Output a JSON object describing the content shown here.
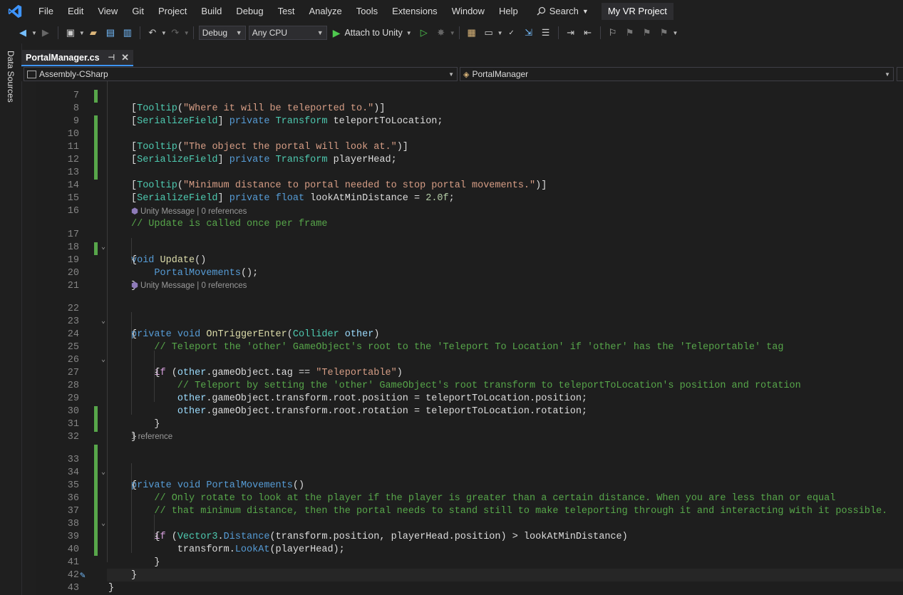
{
  "menubar": {
    "items": [
      "File",
      "Edit",
      "View",
      "Git",
      "Project",
      "Build",
      "Debug",
      "Test",
      "Analyze",
      "Tools",
      "Extensions",
      "Window",
      "Help"
    ],
    "search_label": "Search",
    "project_title": "My VR Project"
  },
  "toolbar": {
    "configuration": "Debug",
    "platform": "Any CPU",
    "attach_label": "Attach to Unity"
  },
  "side_panel": {
    "label": "Data Sources"
  },
  "tab": {
    "label": "PortalManager.cs"
  },
  "navbar": {
    "left": "Assembly-CSharp",
    "right": "PortalManager"
  },
  "code_lens": {
    "unity_message": "Unity Message | 0 references",
    "one_reference": "1 reference"
  },
  "code": {
    "line_numbers": [
      "7",
      "8",
      "9",
      "10",
      "11",
      "12",
      "13",
      "14",
      "15",
      "16",
      "17",
      "18",
      "19",
      "20",
      "21",
      "22",
      "23",
      "24",
      "25",
      "26",
      "27",
      "28",
      "29",
      "30",
      "31",
      "32",
      "33",
      "34",
      "35",
      "36",
      "37",
      "38",
      "39",
      "40",
      "41",
      "42",
      "43"
    ]
  },
  "colors": {
    "keyword": "#569cd6",
    "control": "#d8a0df",
    "type": "#4ec9b0",
    "string": "#d69d85",
    "comment": "#57a64a",
    "method": "#dcdcaa",
    "change_bar": "#57a64a",
    "accent": "#3e95ff"
  }
}
